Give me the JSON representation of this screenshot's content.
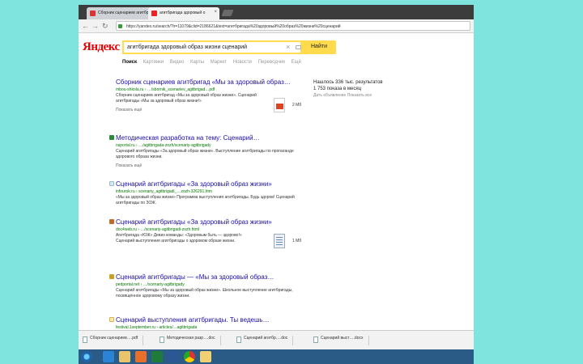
{
  "browser": {
    "tabs": [
      {
        "label": "Сборник сценариев агитбригад",
        "active": false
      },
      {
        "label": "агитбригада здоровый о",
        "active": true
      }
    ],
    "address": "https://yandex.ru/search/?lr=11079&clid=2186621&text=агитбригада%20здоровый%20образ%20жизни%20сценарий"
  },
  "search": {
    "logo_main": "Яндекс",
    "query": "агитбригада здоровый образ жизни сценарий",
    "button": "Найти",
    "verticals": [
      "Поиск",
      "Картинки",
      "Видео",
      "Карты",
      "Маркет",
      "Новости",
      "Переводчик",
      "Ещё"
    ]
  },
  "stats": {
    "found": "Нашлось 336 тыс. результатов",
    "ads": "1 753 показа в месяц",
    "links": "Дать объявление   Показать все"
  },
  "results": [
    {
      "title": "Сборник сценариев агитбригад «Мы за здоровый образ…",
      "url": "mbou-shkola.ru › …/sbornik_scenariev_agitbrigad…pdf",
      "snippet": "Сборник сценариев агитбригад «Мы за здоровый образ жизни». Сценарий агитбригады «Мы за здоровый образ жизни!»",
      "more": "Показать ещё",
      "doc": "pdf",
      "doc_size": "2 Мб"
    },
    {
      "title": "Методическая разработка на тему: Сценарий…",
      "url": "nsportal.ru › …/agitbrigada-zozh/scenariy-agitbrigady",
      "snippet": "Сценарий агитбригады «За здоровый образ жизни». Выступление агитбригады по пропаганде здорового образа жизни.",
      "more": "Показать ещё"
    },
    {
      "title": "Сценарий агитбригады «За здоровый образ жизни»",
      "url": "infourok.ru › scenariy_agitbrigadi_…zozh-326291.htm",
      "snippet": "«Мы за здоровый образ жизни» Программа выступления агитбригады. Будь здоров! Сценарий агитбригады по ЗОЖ."
    },
    {
      "title": "Сценарий агитбригады «За здоровый образ жизни»",
      "url": "doc4web.ru › …/scenariy-agitbrigadi-zozh.html",
      "snippet": "Агитбригада «ЮЖ» Девиз команды: «Здоровым быть — здорово!» Сценарий выступления агитбригады о здоровом образе жизни.",
      "doc": "doc",
      "doc_size": "1 Мб"
    },
    {
      "title": "Сценарий агитбригады — «Мы за здоровый образ…",
      "url": "pedportal.net › …/scenariy-agitbrigady",
      "snippet": "Сценарий агитбригады «Мы за здоровый образ жизни». Школьное выступление агитбригады, посвящённое здоровому образу жизни."
    },
    {
      "title": "Сценарий выступления агитбригады. Ты ведешь…",
      "url": "festival.1september.ru › articles/…agitbrigada",
      "snippet": ""
    }
  ],
  "downloads": [
    "Сборник сценариев….pdf",
    "Методическая разр….doc",
    "Сценарий агитбр….doc",
    "Сценарий выст….docx"
  ],
  "taskbar": [
    "start",
    "ie",
    "explorer",
    "media",
    "excel",
    "word",
    "chrome",
    "folder"
  ],
  "colors": {
    "bg": "#7fe3de",
    "brand": "#ff0000",
    "search_border": "#ffdb4d",
    "link": "#1a0dab",
    "url": "#007700",
    "taskbar": "#2a5b86"
  }
}
